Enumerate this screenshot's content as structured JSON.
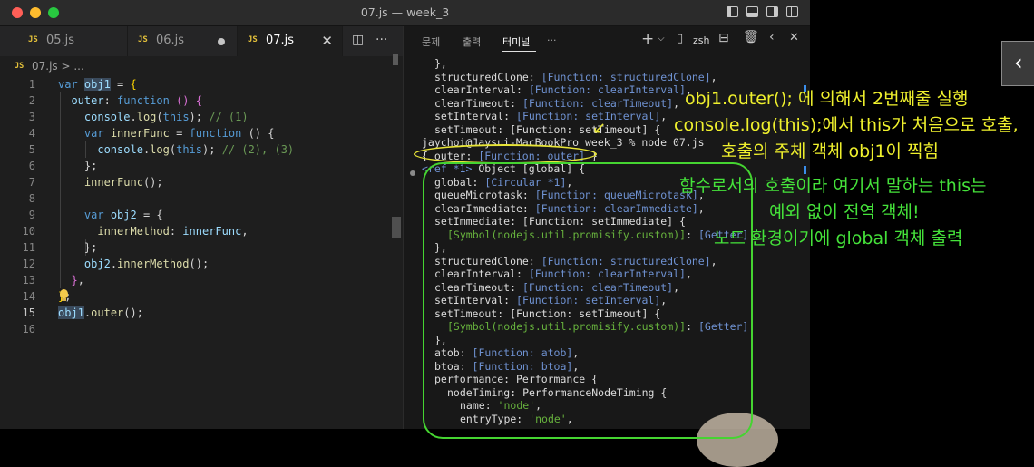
{
  "window": {
    "title": "07.js — week_3"
  },
  "editor": {
    "tabs": [
      {
        "icon": "JS",
        "label": "05.js"
      },
      {
        "icon": "JS",
        "label": "06.js"
      },
      {
        "icon": "JS",
        "label": "07.js"
      }
    ],
    "breadcrumb": {
      "icon": "JS",
      "file": "07.js",
      "sep": " > ..."
    },
    "line_numbers": [
      "1",
      "2",
      "3",
      "4",
      "5",
      "6",
      "7",
      "8",
      "9",
      "10",
      "11",
      "12",
      "13",
      "14",
      "15",
      "16"
    ]
  },
  "panel": {
    "tabs": [
      "문제",
      "출력",
      "터미널",
      "···"
    ],
    "shell": "zsh",
    "prompt_line": "jaychoi@Jaysui-MacBookPro week_3 % node 07.js"
  },
  "annotations": {
    "yellow": [
      "obj1.outer(); 에 의해서 2번째줄 실행",
      "console.log(this);에서 this가 처음으로 호출,",
      "호출의 주체 객체 obj1이 찍힘"
    ],
    "green": [
      "함수로서의 호출이라 여기서 말하는 this는",
      "예외 없이 전역 객체!",
      "노드 환경이기에 global 객체 출력"
    ]
  },
  "colors": {
    "annotation_yellow": "#eff02d",
    "annotation_green": "#45e23a",
    "ellipse": "#e8e437",
    "box": "#45d431"
  }
}
